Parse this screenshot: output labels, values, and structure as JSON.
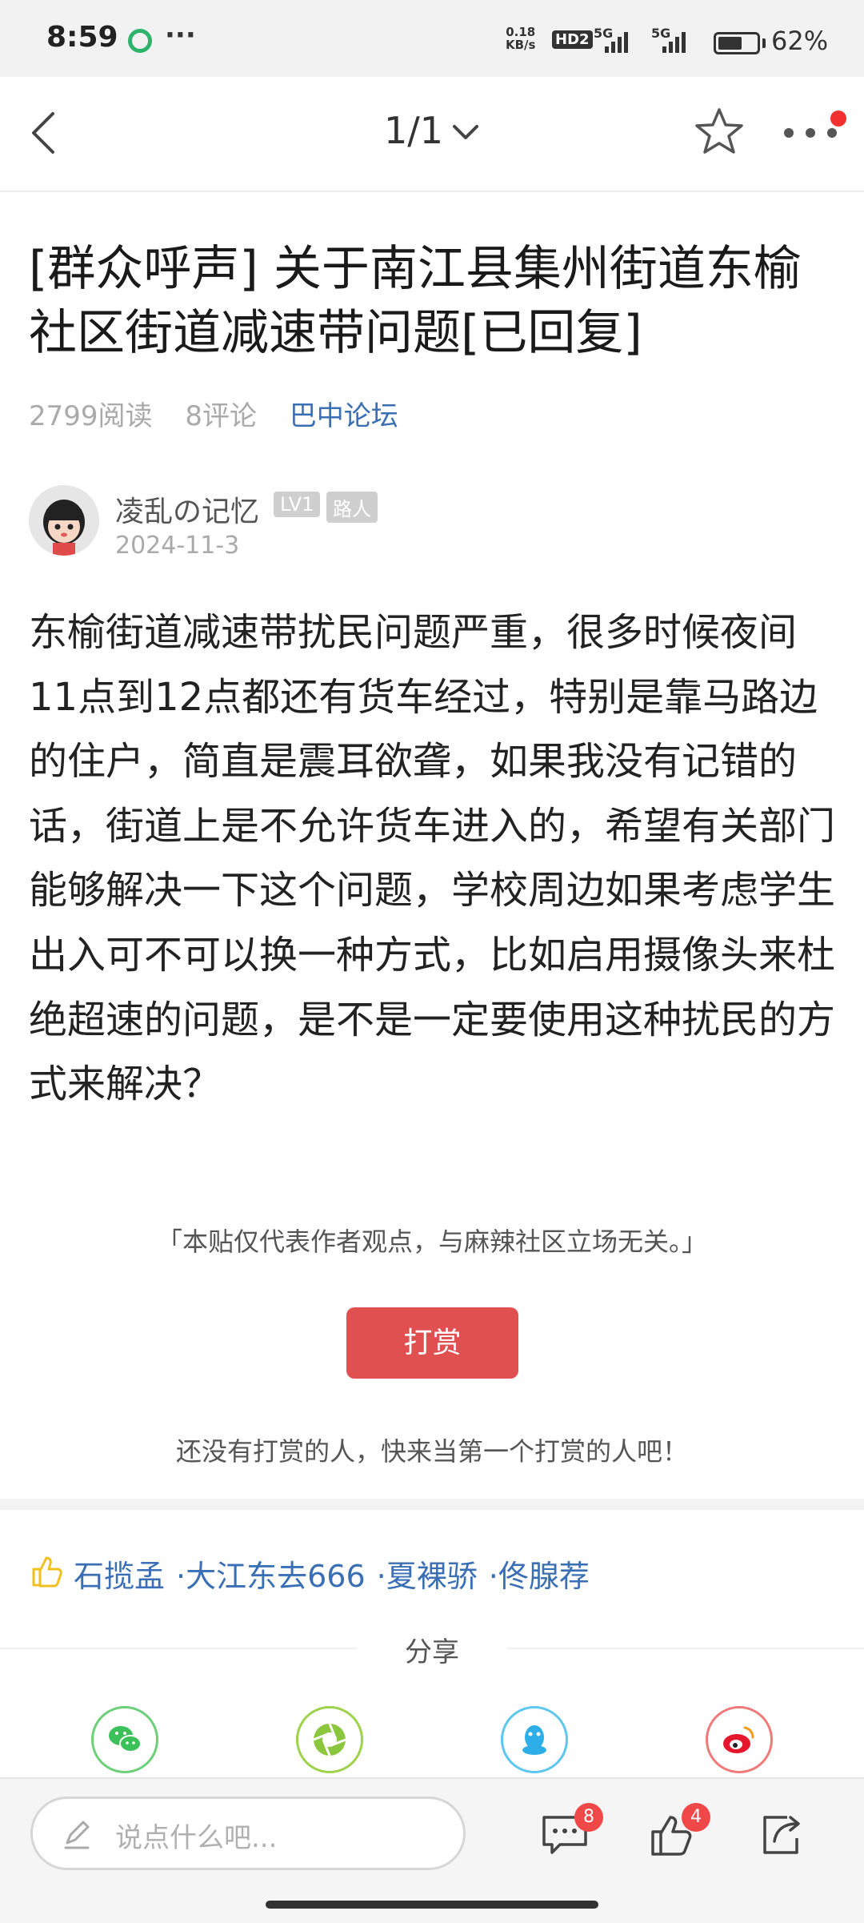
{
  "status_bar": {
    "time": "8:59",
    "app_icon": "c-circle-icon",
    "dots": "···",
    "net_speed_value": "0.18",
    "net_speed_unit": "KB/s",
    "hd_badge": "HD2",
    "signal_1": "5G",
    "signal_2": "5G",
    "battery_level": 0.62,
    "battery_percent": "62%"
  },
  "nav": {
    "page_indicator": "1/1",
    "notify_dot_color": "#f23030"
  },
  "post": {
    "title": "[群众呼声] 关于南江县集州街道东榆社区街道减速带问题[已回复]",
    "reads": "2799阅读",
    "comments": "8评论",
    "forum": "巴中论坛",
    "author": "凌乱の记忆",
    "level_badge": "LV1",
    "role_badge": "路人",
    "date": "2024-11-3",
    "body": "东榆街道减速带扰民问题严重，很多时候夜间11点到12点都还有货车经过，特别是靠马路边的住户，简直是震耳欲聋，如果我没有记错的话，街道上是不允许货车进入的，希望有关部门能够解决一下这个问题，学校周边如果考虑学生出入可不可以换一种方式，比如启用摄像头来杜绝超速的问题，是不是一定要使用这种扰民的方式来解决？"
  },
  "disclaimer": "「本贴仅代表作者观点，与麻辣社区立场无关。」",
  "reward": {
    "button_label": "打赏",
    "hint": "还没有打赏的人，快来当第一个打赏的人吧！",
    "button_color": "#e05050"
  },
  "likers": [
    "石揽孟",
    "·大江东去666",
    "·夏裸骄",
    "·佟腺荐"
  ],
  "share": {
    "label": "分享",
    "targets": [
      "wechat-icon",
      "moments-icon",
      "qq-icon",
      "weibo-icon"
    ]
  },
  "bottom_bar": {
    "placeholder": "说点什么吧...",
    "comments_count": "8",
    "likes_count": "4"
  },
  "accent_link_color": "#3a6fb5"
}
